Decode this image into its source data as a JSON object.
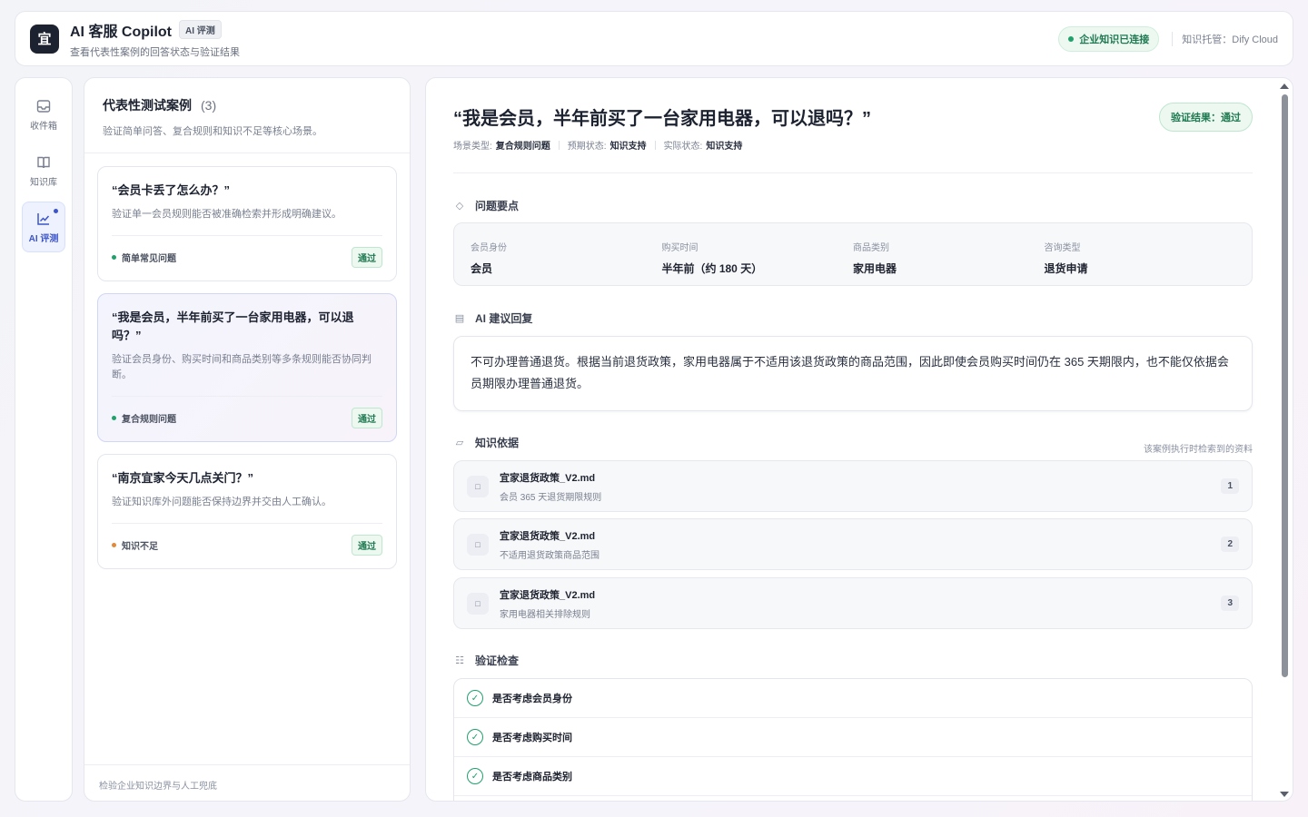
{
  "header": {
    "logo_char": "宜",
    "title": "AI 客服 Copilot",
    "tag": "AI 评测",
    "subtitle": "查看代表性案例的回答状态与验证结果",
    "connection": "企业知识已连接",
    "host": "知识托管：Dify Cloud"
  },
  "rail": {
    "items": [
      {
        "label": "收件箱",
        "icon": "inbox-icon"
      },
      {
        "label": "知识库",
        "icon": "book-icon"
      },
      {
        "label": "AI 评测",
        "icon": "chart-line-icon"
      }
    ]
  },
  "list": {
    "title": "代表性测试案例",
    "count": "(3)",
    "desc": "验证简单问答、复合规则和知识不足等核心场景。",
    "cards": [
      {
        "question": "“会员卡丢了怎么办？”",
        "desc": "验证单一会员规则能否被准确检索并形成明确建议。",
        "type": "简单常见问题",
        "type_color": "#22a06b",
        "result": "通过"
      },
      {
        "question": "“我是会员，半年前买了一台家用电器，可以退吗？”",
        "desc": "验证会员身份、购买时间和商品类别等多条规则能否协同判断。",
        "type": "复合规则问题",
        "type_color": "#22a06b",
        "result": "通过"
      },
      {
        "question": "“南京宜家今天几点关门？”",
        "desc": "验证知识库外问题能否保持边界并交由人工确认。",
        "type": "知识不足",
        "type_color": "#e08a3a",
        "result": "通过"
      }
    ],
    "footer": "检验企业知识边界与人工兜底"
  },
  "detail": {
    "title": "“我是会员，半年前买了一台家用电器，可以退吗？”",
    "verdict": "验证结果：通过",
    "meta": {
      "scene_label": "场景类型:",
      "scene_value": "复合规则问题",
      "expected_label": "预期状态:",
      "expected_value": "知识支持",
      "actual_label": "实际状态:",
      "actual_value": "知识支持"
    },
    "points_title": "问题要点",
    "facts": [
      {
        "key": "会员身份",
        "value": "会员"
      },
      {
        "key": "购买时间",
        "value": "半年前（约 180 天）"
      },
      {
        "key": "商品类别",
        "value": "家用电器"
      },
      {
        "key": "咨询类型",
        "value": "退货申请"
      }
    ],
    "reply_title": "AI 建议回复",
    "reply": "不可办理普通退货。根据当前退货政策，家用电器属于不适用该退货政策的商品范围，因此即使会员购买时间仍在 365 天期限内，也不能仅依据会员期限办理普通退货。",
    "sources_title": "知识依据",
    "sources_hint": "该案例执行时检索到的资料",
    "sources": [
      {
        "name": "宜家退货政策_V2.md",
        "sub": "会员 365 天退货期限规则",
        "num": "1"
      },
      {
        "name": "宜家退货政策_V2.md",
        "sub": "不适用退货政策商品范围",
        "num": "2"
      },
      {
        "name": "宜家退货政策_V2.md",
        "sub": "家用电器相关排除规则",
        "num": "3"
      }
    ],
    "checks_title": "验证检查",
    "checks": [
      {
        "label": "是否考虑会员身份"
      },
      {
        "label": "是否考虑购买时间"
      },
      {
        "label": "是否考虑商品类别"
      }
    ]
  },
  "colors": {
    "accent": "#3c55c8",
    "success": "#22a06b",
    "warn": "#e08a3a"
  }
}
